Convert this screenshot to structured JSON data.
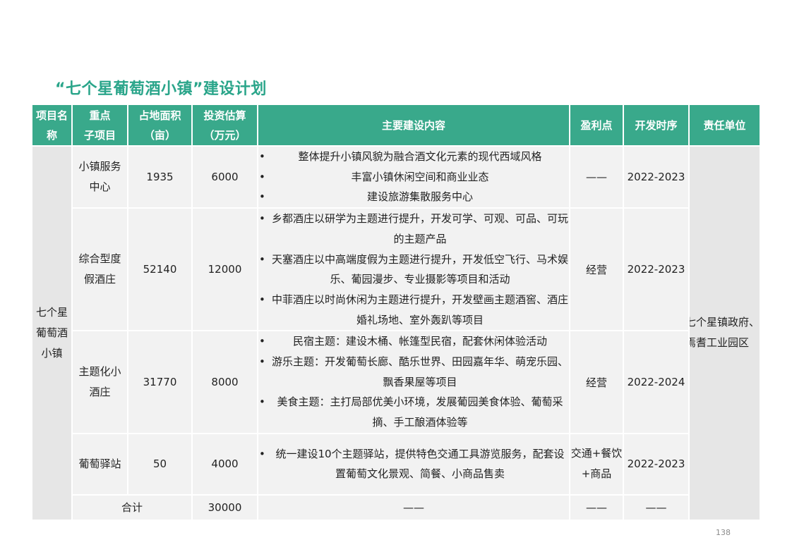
{
  "title": "“七个星葡萄酒小镇”建设计划",
  "headers": {
    "project_line1": "项目名",
    "project_line2": "称",
    "sub_line1": "重点",
    "sub_line2": "子项目",
    "area_line1": "占地面积",
    "area_line2": "（亩）",
    "invest_line1": "投资估算",
    "invest_line2": "（万元）",
    "content": "主要建设内容",
    "profit": "盈利点",
    "schedule": "开发时序",
    "responsible": "责任单位"
  },
  "project": {
    "line1": "七个星",
    "line2": "葡萄酒",
    "line3": "小镇"
  },
  "responsible": {
    "line1": "七个星镇政府、",
    "line2": "焉耆工业园区"
  },
  "rows": [
    {
      "sub_line1": "小镇服务",
      "sub_line2": "中心",
      "area": "1935",
      "invest": "6000",
      "content": [
        "整体提升小镇风貌为融合酒文化元素的现代西域风格",
        "丰富小镇休闲空间和商业业态",
        "建设旅游集散服务中心"
      ],
      "profit_line1": "——",
      "profit_line2": "",
      "schedule": "2022-2023"
    },
    {
      "sub_line1": "综合型度",
      "sub_line2": "假酒庄",
      "area": "52140",
      "invest": "12000",
      "content": [
        "乡都酒庄以研学为主题进行提升，开发可学、可观、可品、可玩的主题产品",
        "天塞酒庄以中高端度假为主题进行提升，开发低空飞行、马术娱乐、葡园漫步、专业摄影等项目和活动",
        "中菲酒庄以时尚休闲为主题进行提升，开发壁画主题酒窖、酒庄婚礼场地、室外轰趴等项目"
      ],
      "profit_line1": "经营",
      "profit_line2": "",
      "schedule": "2022-2023"
    },
    {
      "sub_line1": "主题化小",
      "sub_line2": "酒庄",
      "area": "31770",
      "invest": "8000",
      "content": [
        "民宿主题：建设木桶、帐篷型民宿，配套休闲体验活动",
        "游乐主题：开发葡萄长廊、酷乐世界、田园嘉年华、萌宠乐园、飘香果屋等项目",
        "美食主题：主打局部优美小环境，发展葡园美食体验、葡萄采摘、手工酿酒体验等"
      ],
      "profit_line1": "经营",
      "profit_line2": "",
      "schedule": "2022-2024"
    },
    {
      "sub_line1": "葡萄驿站",
      "sub_line2": "",
      "area": "50",
      "invest": "4000",
      "content": [
        "统一建设10个主题驿站，提供特色交通工具游览服务，配套设置葡萄文化景观、简餐、小商品售卖"
      ],
      "profit_line1": "交通+餐饮",
      "profit_line2": "+商品",
      "schedule": "2022-2023"
    }
  ],
  "total": {
    "label": "合计",
    "invest": "30000",
    "content": "——",
    "profit": "——",
    "schedule": "——"
  },
  "page_number": "138",
  "colors": {
    "accent": "#2aa58a",
    "header_bg": "#39a98b",
    "row_light": "#f2f2f2",
    "row_gray": "#e6e6e6"
  }
}
